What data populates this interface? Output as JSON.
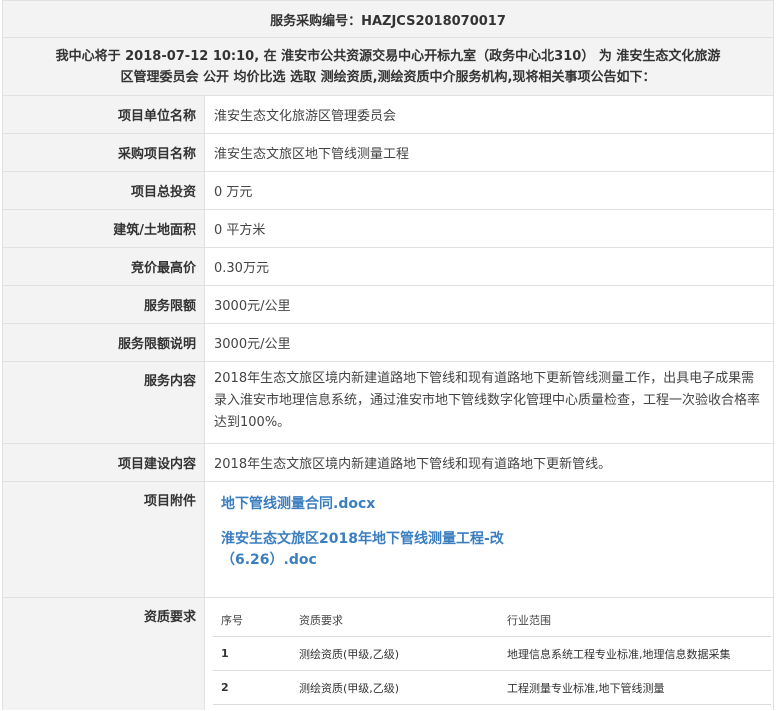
{
  "header": {
    "title": "服务采购编号：HAZJCS2018070017"
  },
  "notice": {
    "line1": "我中心将于 2018-07-12 10:10, 在 淮安市公共资源交易中心开标九室（政务中心北310） 为 淮安生态文化旅游",
    "line2": "区管理委员会 公开 均价比选 选取 测绘资质,测绘资质中介服务机构,现将相关事项公告如下："
  },
  "rows": [
    {
      "label": "项目单位名称",
      "value": "淮安生态文化旅游区管理委员会"
    },
    {
      "label": "采购项目名称",
      "value": "淮安生态文旅区地下管线测量工程"
    },
    {
      "label": "项目总投资",
      "value": "0 万元"
    },
    {
      "label": "建筑/土地面积",
      "value": "0 平方米"
    },
    {
      "label": "竞价最高价",
      "value": "0.30万元"
    },
    {
      "label": "服务限额",
      "value": "3000元/公里"
    },
    {
      "label": "服务限额说明",
      "value": "3000元/公里"
    },
    {
      "label": "服务内容",
      "value": "2018年生态文旅区境内新建道路地下管线和现有道路地下更新管线测量工作，出具电子成果需录入淮安市地理信息系统，通过淮安市地下管线数字化管理中心质量检查，工程一次验收合格率达到100%。"
    },
    {
      "label": "项目建设内容",
      "value": "2018年生态文旅区境内新建道路地下管线和现有道路地下更新管线。"
    },
    {
      "label": "项目附件",
      "value": ""
    },
    {
      "label": "资质要求",
      "value": ""
    }
  ],
  "attachments": [
    {
      "name": "地下管线测量合同.docx"
    },
    {
      "name_line1": "淮安生态文旅区2018年地下管线测量工程-改",
      "name_line2": "（6.26）.doc"
    }
  ],
  "qualification_table": {
    "headers": [
      "序号",
      "资质要求",
      "行业范围"
    ],
    "rows": [
      [
        "1",
        "测绘资质(甲级,乙级)",
        "地理信息系统工程专业标准,地理信息数据采集"
      ],
      [
        "2",
        "测绘资质(甲级,乙级)",
        "工程测量专业标准,地下管线测量"
      ]
    ]
  }
}
